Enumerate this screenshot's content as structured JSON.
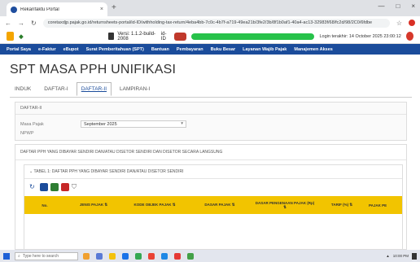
{
  "browser": {
    "tab_title": "Rekanfaktu Portal",
    "tab_close": "×",
    "new_tab": "+",
    "window_controls": [
      "—",
      "□",
      "×"
    ],
    "url": "coretaxdjp.pajak.go.id/returnsheets-portal/id-ID/withholding-tax-return/4eba4bb-7c0c-4b7f-a719-49ea21b/3fe2/3b/8f1b0af1-40a4-ac13-32983f/68/fc2d/98/2C0/6fdbe",
    "nav_icons": [
      "←",
      "→",
      "↻"
    ]
  },
  "appbar": {
    "version": "Versi: 1.1.2-build-2008",
    "id_label": "id-ID",
    "login_text": "Login terakhir: 14 October 2025 23:00:12"
  },
  "nav_menu": [
    "Portal Saya",
    "e-Faktur",
    "eBupot",
    "Surat Pemberitahuan (SPT)",
    "Bantuan",
    "Pembayaran",
    "Buku Besar",
    "Layanan Wajib Pajak",
    "Manajemen Akses"
  ],
  "page": {
    "title": "SPT MASA PPH UNIFIKASI",
    "tabs": [
      "INDUK",
      "DAFTAR-I",
      "DAFTAR-II",
      "LAMPIRAN-I"
    ],
    "active_tab": "DAFTAR-II"
  },
  "section1": {
    "header": "DAFTAR-II",
    "field1_label": "Masa Pajak",
    "field1_value": "September 2025",
    "field2_label": "NPWP"
  },
  "section2": {
    "header": "DAFTAR PPH YANG DIBAYAR SENDIRI DAN/ATAU DISETOR SENDIRI DAN DISETOR SECARA LANGSUNG",
    "subheader": "TABEL 1: DAFTAR PPH YANG DIBAYAR SENDIRI DAN/ATAU DISETOR SENDIRI",
    "columns": [
      "No.",
      "JENIS PAJAK ⇅",
      "KODE OBJEK PAJAK ⇅",
      "DASAR PAJAK ⇅",
      "DASAR PENGENAAN PAJAK (Rp) ⇅",
      "TARIF (%) ⇅",
      "PAJAK PE"
    ]
  },
  "taskbar": {
    "search_placeholder": "Type here to search",
    "tray_text": "10:00 PM"
  },
  "colors": {
    "nav_blue": "#1b4c9b",
    "table_header_yellow": "#f2c400",
    "logout_red": "#d6382b"
  }
}
